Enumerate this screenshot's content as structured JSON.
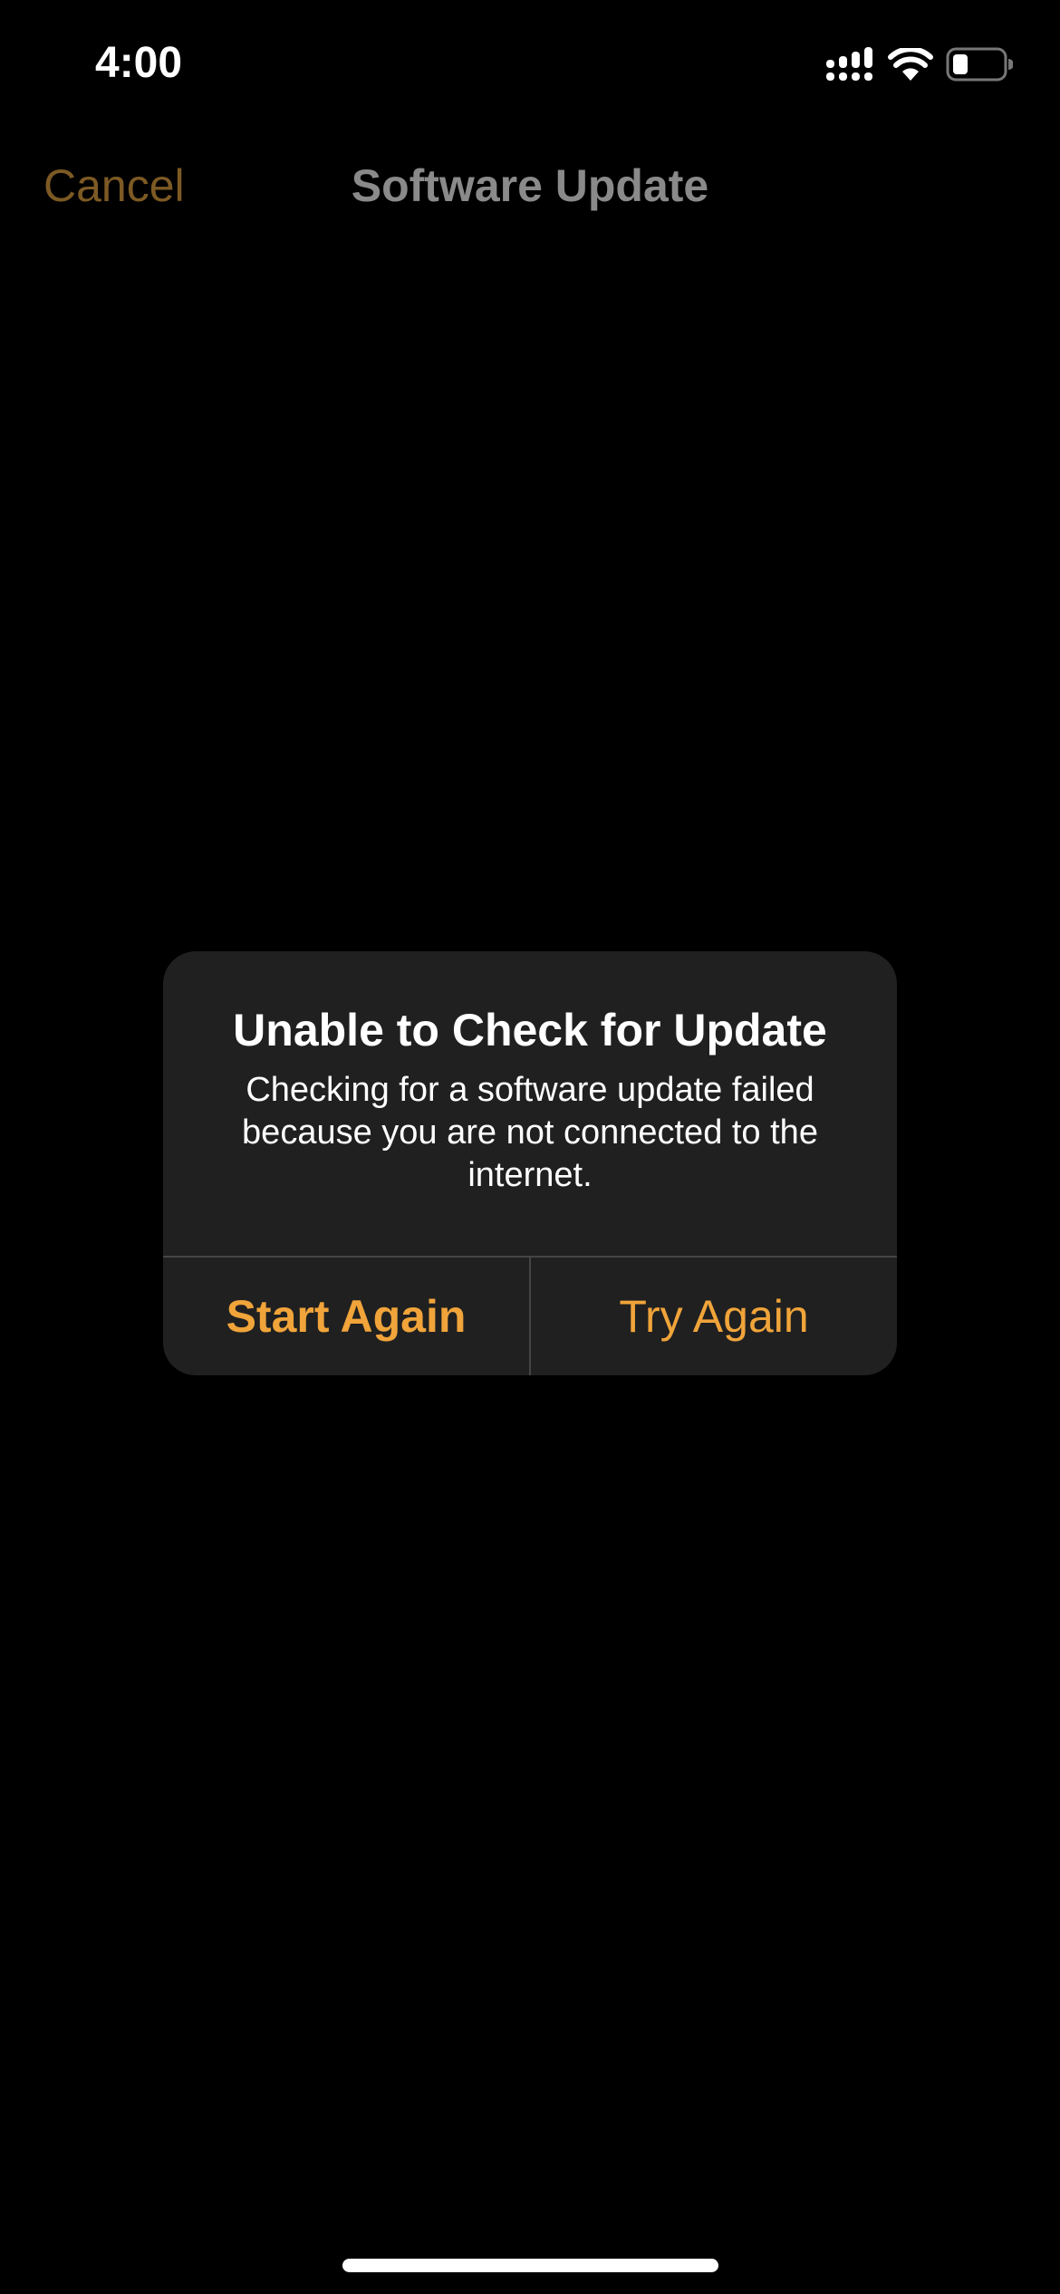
{
  "status_bar": {
    "time": "4:00",
    "icons": [
      "cellular-signal-icon",
      "wifi-icon",
      "battery-icon"
    ],
    "battery_level": 0.2
  },
  "nav": {
    "cancel_label": "Cancel",
    "title": "Software Update"
  },
  "alert": {
    "title": "Unable to Check for Update",
    "message": "Checking for a software update failed because you are not connected to the internet.",
    "buttons": [
      {
        "label": "Start Again"
      },
      {
        "label": "Try Again"
      }
    ]
  },
  "colors": {
    "accent": "#f0a43a",
    "dimmed_accent": "#7d5a24",
    "dialog_bg": "#202020",
    "background": "#000000"
  }
}
